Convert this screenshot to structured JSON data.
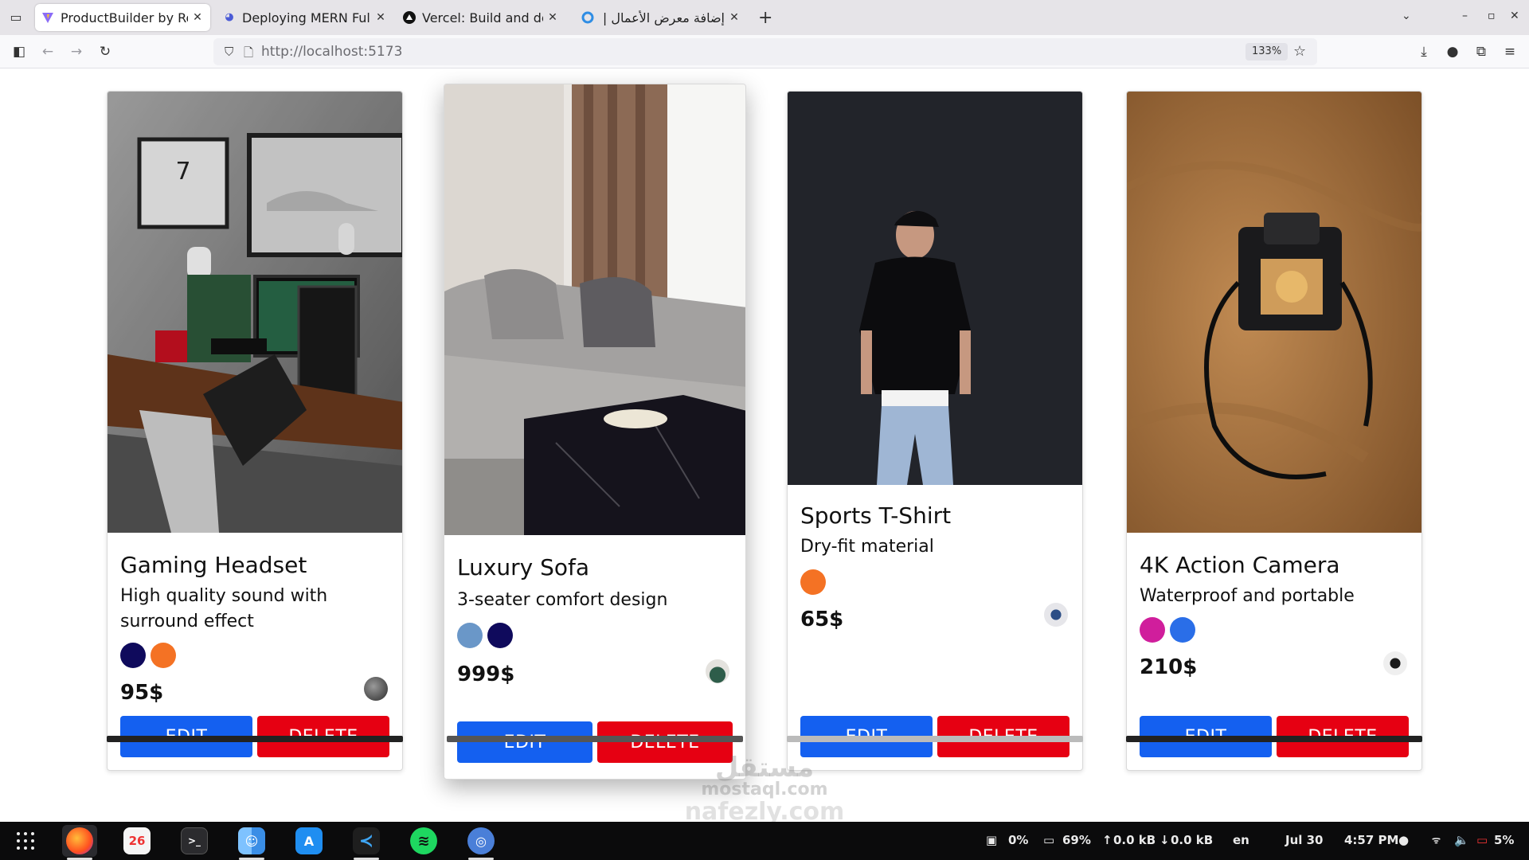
{
  "browser": {
    "tabs": [
      {
        "title": "ProductBuilder by Rou",
        "active": true,
        "icon": "vite-icon"
      },
      {
        "title": "Deploying MERN Full-S",
        "active": false,
        "icon": "render-icon"
      },
      {
        "title": "Vercel: Build and deplo",
        "active": false,
        "icon": "vercel-icon"
      },
      {
        "title": "إضافة معرض الأعمال |",
        "active": false,
        "icon": "loading-icon"
      }
    ],
    "url": "http://localhost:5173",
    "zoom": "133%"
  },
  "products": [
    {
      "name": "Gaming Headset",
      "description": "High quality sound with surround effect",
      "colors": [
        "#0f0a5c",
        "#f47224"
      ],
      "price": "95$",
      "edit_label": "EDIT",
      "delete_label": "DELETE"
    },
    {
      "name": "Luxury Sofa",
      "description": "3-seater comfort design",
      "colors": [
        "#6a97c8",
        "#0f0a5c"
      ],
      "price": "999$",
      "edit_label": "EDIT",
      "delete_label": "DELETE"
    },
    {
      "name": "Sports T-Shirt",
      "description": "Dry-fit material",
      "colors": [
        "#f47224"
      ],
      "price": "65$",
      "edit_label": "EDIT",
      "delete_label": "DELETE"
    },
    {
      "name": "4K Action Camera",
      "description": "Waterproof and portable",
      "colors": [
        "#d01e9c",
        "#2a6ee8"
      ],
      "price": "210$",
      "edit_label": "EDIT",
      "delete_label": "DELETE"
    }
  ],
  "watermark": {
    "line1": "مستقل",
    "line2": "mostaql.com",
    "line3": "nafezly.com"
  },
  "taskbar": {
    "calendar_day": "26",
    "cpu": "0%",
    "mem": "69%",
    "upload": "0.0 kB",
    "download": "0.0 kB",
    "lang": "en",
    "date": "Jul 30",
    "time": "4:57 PM",
    "battery": "5%"
  }
}
